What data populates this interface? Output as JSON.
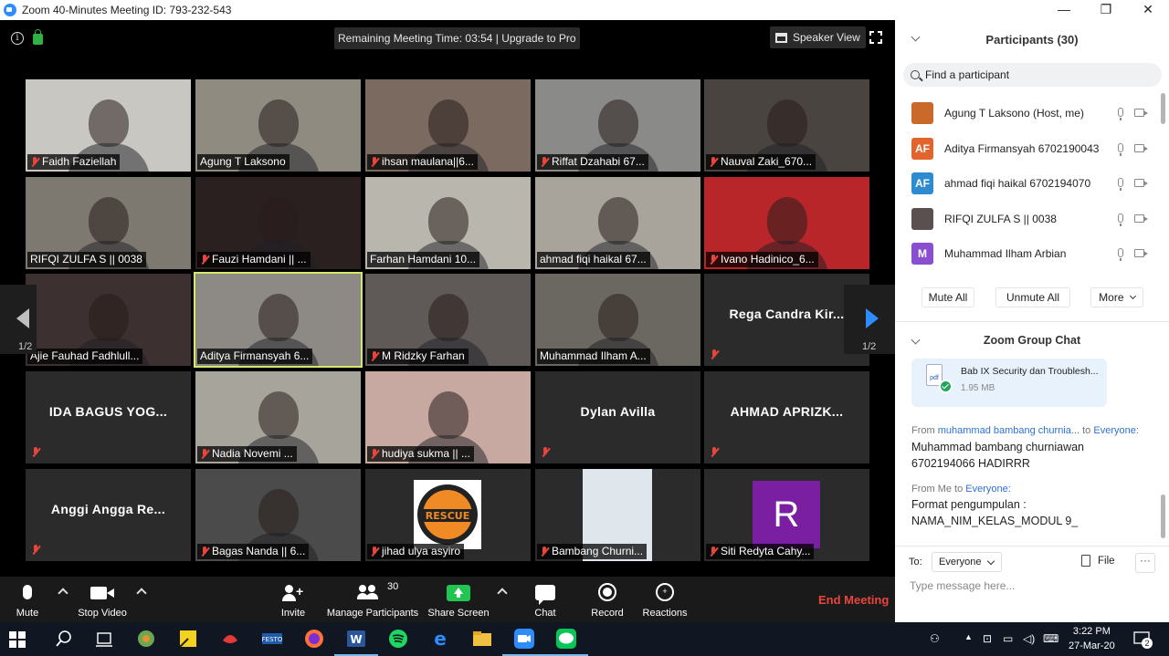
{
  "window": {
    "title": "Zoom 40-Minutes Meeting ID: 793-232-543",
    "controls": {
      "minimize": "—",
      "restore": "❐",
      "close": "✕"
    }
  },
  "stage": {
    "remaining_text": "Remaining Meeting Time: 03:54 | Upgrade to Pro",
    "speaker_view_label": "Speaker View",
    "page_left": "1/2",
    "page_right": "1/2"
  },
  "tiles": [
    {
      "name": "Faidh Faziellah",
      "muted": true,
      "video": true,
      "bg": "#c9c7c2"
    },
    {
      "name": "Agung T Laksono",
      "muted": false,
      "video": true,
      "bg": "#8f8b80"
    },
    {
      "name": "ihsan maulana||6...",
      "muted": true,
      "video": true,
      "bg": "#7a6a60"
    },
    {
      "name": "Riffat Dzahabi 67...",
      "muted": true,
      "video": true,
      "bg": "#8a8a88"
    },
    {
      "name": "Nauval Zaki_670...",
      "muted": true,
      "video": true,
      "bg": "#4a4440"
    },
    {
      "name": "RIFQI ZULFA S || 0038",
      "muted": false,
      "video": true,
      "bg": "#7d7870"
    },
    {
      "name": "Fauzi Hamdani || ...",
      "muted": true,
      "video": true,
      "bg": "#2a2020"
    },
    {
      "name": "Farhan Hamdani 10...",
      "muted": false,
      "video": true,
      "bg": "#b9b6ae"
    },
    {
      "name": "ahmad fiqi haikal 67...",
      "muted": false,
      "video": true,
      "bg": "#a8a49c"
    },
    {
      "name": "Ivano Hadinico_6...",
      "muted": true,
      "video": true,
      "bg": "#b8262a"
    },
    {
      "name": "Ajie Fauhad Fadhlull...",
      "muted": false,
      "video": true,
      "bg": "#3d3030"
    },
    {
      "name": "Aditya Firmansyah 6...",
      "muted": false,
      "video": true,
      "bg": "#8d8a86",
      "active": true
    },
    {
      "name": "M Ridzky Farhan",
      "muted": true,
      "video": true,
      "bg": "#5f5a58"
    },
    {
      "name": "Muhammad Ilham A...",
      "muted": false,
      "video": true,
      "bg": "#6a6860"
    },
    {
      "name": "Rega Candra Kir...",
      "muted": true,
      "video": false
    },
    {
      "name": "IDA BAGUS YOG...",
      "muted": true,
      "video": false
    },
    {
      "name": "Nadia Novemi ...",
      "muted": true,
      "video": true,
      "bg": "#a7a49c"
    },
    {
      "name": "hudiya sukma || ...",
      "muted": true,
      "video": true,
      "bg": "#c7a9a2"
    },
    {
      "name": "Dylan Avilla",
      "muted": true,
      "video": false
    },
    {
      "name": "AHMAD APRIZK...",
      "muted": true,
      "video": false
    },
    {
      "name": "Anggi Angga Re...",
      "muted": true,
      "video": false
    },
    {
      "name": "Bagas Nanda || 6...",
      "muted": true,
      "video": true,
      "bg": "#4b4b4b"
    },
    {
      "name": "jihad ulya asyiro",
      "muted": true,
      "video": true,
      "bg": "#2b2b2b",
      "logo": "RESCUE"
    },
    {
      "name": "Bambang Churni...",
      "muted": true,
      "video": true,
      "bg": "#2b2b2b",
      "inset": "#dfe6ec"
    },
    {
      "name": "Siti Redyta Cahy...",
      "muted": true,
      "video": true,
      "bg": "#2b2b2b",
      "avatar_letter": "R",
      "avatar_color": "#7b1fa2"
    }
  ],
  "toolbar": {
    "mute": "Mute",
    "stop_video": "Stop Video",
    "invite": "Invite",
    "manage_participants": "Manage Participants",
    "participant_count": "30",
    "share_screen": "Share Screen",
    "chat": "Chat",
    "record": "Record",
    "reactions": "Reactions",
    "end_meeting": "End Meeting"
  },
  "participants_panel": {
    "title": "Participants (30)",
    "search_placeholder": "Find a participant",
    "items": [
      {
        "name": "Agung T Laksono (Host, me)",
        "avatar": "",
        "color": "#c96a2a"
      },
      {
        "name": "Aditya Firmansyah 6702190043",
        "avatar": "AF",
        "color": "#e0642c"
      },
      {
        "name": "ahmad fiqi haikal 6702194070",
        "avatar": "AF",
        "color": "#2d8ccf"
      },
      {
        "name": "RIFQI ZULFA S || 0038",
        "avatar": "",
        "color": "#5a5050"
      },
      {
        "name": "Muhammad Ilham Arbian",
        "avatar": "M",
        "color": "#8a4fd0"
      }
    ],
    "mute_all": "Mute All",
    "unmute_all": "Unmute All",
    "more": "More"
  },
  "chat_panel": {
    "title": "Zoom Group Chat",
    "file": {
      "name": "Bab IX Security dan Troublesh...",
      "size": "1.95 MB",
      "icon_text": "pdf"
    },
    "messages": [
      {
        "from_prefix": "From",
        "from": "muhammad bambang churnia...",
        "to_prefix": "to",
        "to": "Everyone:",
        "lines": [
          "Muhammad bambang churniawan",
          "6702194066 HADIRRR"
        ]
      },
      {
        "from_prefix": "From Me to",
        "from": "",
        "to_prefix": "",
        "to": "Everyone:",
        "lines": [
          "Format pengumpulan :",
          "NAMA_NIM_KELAS_MODUL 9_"
        ]
      }
    ],
    "to_label": "To:",
    "to_value": "Everyone",
    "file_button": "File",
    "more_button": "···",
    "input_placeholder": "Type message here..."
  },
  "taskbar": {
    "time": "3:22 PM",
    "date": "27-Mar-20",
    "notification_count": "2"
  }
}
